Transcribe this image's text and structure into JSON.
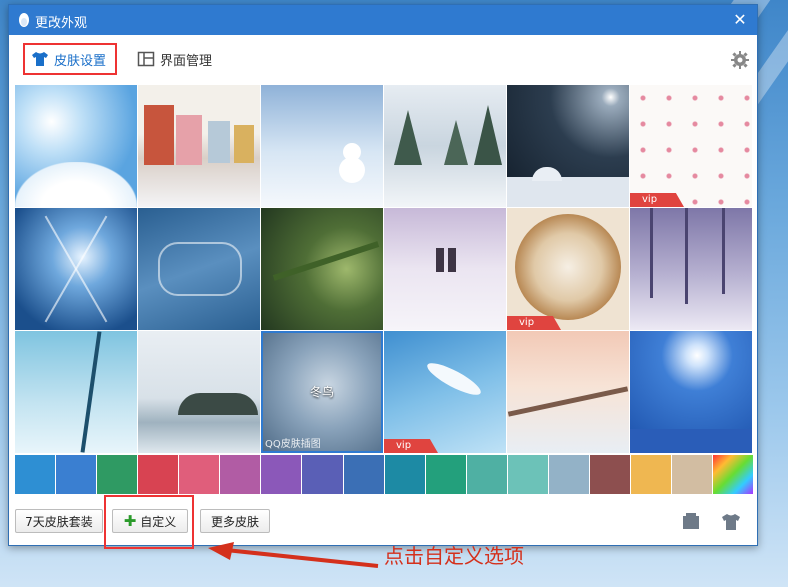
{
  "window": {
    "title": "更改外观",
    "close_glyph": "✕"
  },
  "tabs": [
    {
      "label": "皮肤设置",
      "icon": "tshirt-icon",
      "active": true
    },
    {
      "label": "界面管理",
      "icon": "layout-icon",
      "active": false
    }
  ],
  "gallery": {
    "tiles": [
      {
        "name": "sky-clouds",
        "caption": "",
        "vip": false
      },
      {
        "name": "snowy-street",
        "caption": "",
        "vip": false
      },
      {
        "name": "snowman",
        "caption": "",
        "vip": false
      },
      {
        "name": "snow-forest",
        "caption": "",
        "vip": false
      },
      {
        "name": "night-umbrella",
        "caption": "",
        "vip": false
      },
      {
        "name": "snowflake-pattern",
        "caption": "",
        "vip": true
      },
      {
        "name": "ice-crystal",
        "caption": "",
        "vip": false
      },
      {
        "name": "merry-christmas",
        "caption": "",
        "vip": false
      },
      {
        "name": "pine-branch",
        "caption": "",
        "vip": false
      },
      {
        "name": "couple-walk",
        "caption": "",
        "vip": false
      },
      {
        "name": "latte-art",
        "caption": "",
        "vip": true
      },
      {
        "name": "purple-trees",
        "caption": "",
        "vip": false
      },
      {
        "name": "blue-branch",
        "caption": "",
        "vip": false
      },
      {
        "name": "winter-birds",
        "caption": "",
        "vip": false
      },
      {
        "name": "winter-bird",
        "caption": "冬鸟",
        "watermark": "QQ皮肤插图",
        "vip": false
      },
      {
        "name": "feather",
        "caption": "",
        "vip": true
      },
      {
        "name": "snow-bridge",
        "caption": "",
        "vip": false
      },
      {
        "name": "moon-reindeer",
        "caption": "",
        "vip": false
      }
    ],
    "vip_label": "vip",
    "swatches": [
      "#2e8fd3",
      "#3a7fd1",
      "#2f9a63",
      "#d84352",
      "#e05e7b",
      "#b15ca4",
      "#8b58b9",
      "#5a5fb6",
      "#3b6fb5",
      "#1d8aa4",
      "#23a07c",
      "#4fb0a3",
      "#6cc2b8",
      "#93b2c7",
      "#8d4f4f",
      "#efb751",
      "#d2bda2",
      "rainbow"
    ]
  },
  "bottom": {
    "seven_day_label": "7天皮肤套装",
    "custom_label": "自定义",
    "more_label": "更多皮肤"
  },
  "annotation": {
    "text": "点击自定义选项"
  }
}
